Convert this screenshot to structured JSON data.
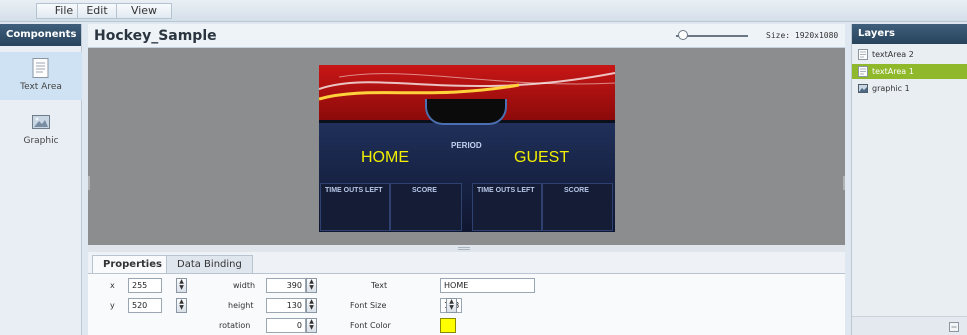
{
  "menu": [
    "File",
    "Edit",
    "View"
  ],
  "components": {
    "title": "Components",
    "items": [
      {
        "label": "Text Area",
        "icon": "text-area-icon",
        "selected": true
      },
      {
        "label": "Graphic",
        "icon": "graphic-icon",
        "selected": false
      }
    ]
  },
  "document": {
    "title": "Hockey_Sample",
    "size_label": "Size: 1920x1080"
  },
  "scoreboard": {
    "home": "HOME",
    "guest": "GUEST",
    "period": "PERIOD",
    "time_outs_left": "TIME OUTS LEFT",
    "score": "SCORE"
  },
  "layers": {
    "title": "Layers",
    "items": [
      {
        "label": "textArea 2",
        "selected": false
      },
      {
        "label": "textArea 1",
        "selected": true
      },
      {
        "label": "graphic 1",
        "selected": false
      }
    ]
  },
  "properties": {
    "tabs": [
      "Properties",
      "Data Binding"
    ],
    "x_label": "x",
    "x_value": "255",
    "y_label": "y",
    "y_value": "520",
    "width_label": "width",
    "width_value": "390",
    "height_label": "height",
    "height_value": "130",
    "rotation_label": "rotation",
    "rotation_value": "0",
    "text_label": "Text",
    "text_value": "HOME",
    "font_size_label": "Font Size",
    "font_size_value": "128",
    "font_color_label": "Font Color",
    "font_color_value": "#ffff00"
  },
  "colors": {
    "accent": "#8fb82b",
    "header": "#28435c",
    "canvas": "#8b8d8f"
  }
}
